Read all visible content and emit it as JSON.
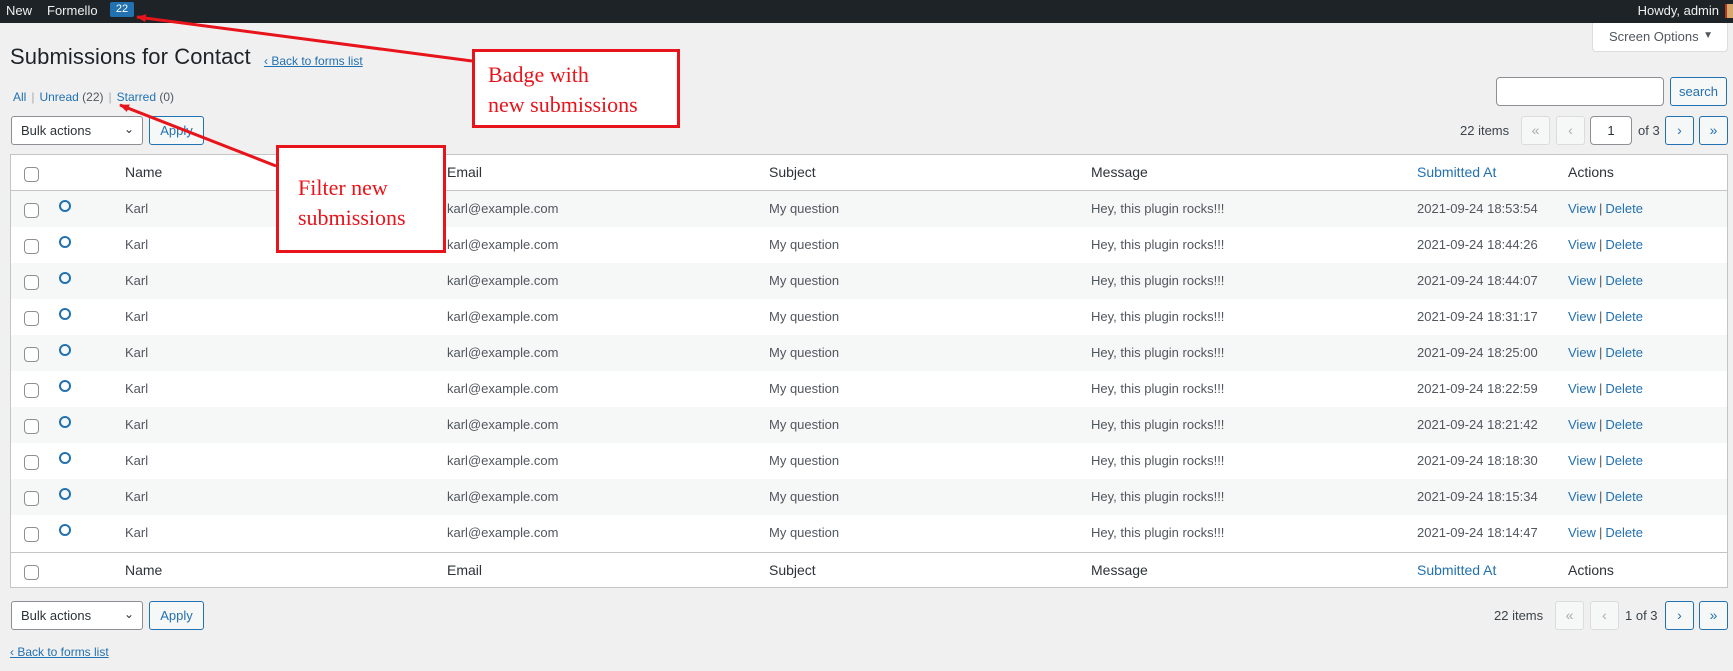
{
  "admin_bar": {
    "new_label": "New",
    "plugin_label": "Formello",
    "badge_count": "22",
    "howdy": "Howdy, admin"
  },
  "screen_options": {
    "label": "Screen Options",
    "caret": "▼"
  },
  "page": {
    "title": "Submissions for Contact",
    "back_link": "‹ Back to forms list"
  },
  "views": {
    "all": "All",
    "sep": "|",
    "unread_label": "Unread",
    "unread_count": "(22)",
    "starred_label": "Starred",
    "starred_count": "(0)"
  },
  "search": {
    "placeholder": "",
    "button": "search"
  },
  "bulk": {
    "label": "Bulk actions",
    "chevron": "⌄",
    "apply": "Apply"
  },
  "pagination_top": {
    "items": "22 items",
    "first": "«",
    "prev": "‹",
    "current": "1",
    "of": "of 3",
    "next": "›",
    "last": "»"
  },
  "pagination_bottom": {
    "items": "22 items",
    "first": "«",
    "prev": "‹",
    "current_text": "1 of 3",
    "next": "›",
    "last": "»"
  },
  "columns": {
    "name": "Name",
    "email": "Email",
    "subject": "Subject",
    "message": "Message",
    "submitted_at": "Submitted At",
    "actions": "Actions"
  },
  "actions": {
    "view": "View",
    "sep": "|",
    "delete": "Delete"
  },
  "rows": [
    {
      "name": "Karl",
      "email": "karl@example.com",
      "subject": "My question",
      "message": "Hey, this plugin rocks!!!",
      "date": "2021-09-24 18:53:54"
    },
    {
      "name": "Karl",
      "email": "karl@example.com",
      "subject": "My question",
      "message": "Hey, this plugin rocks!!!",
      "date": "2021-09-24 18:44:26"
    },
    {
      "name": "Karl",
      "email": "karl@example.com",
      "subject": "My question",
      "message": "Hey, this plugin rocks!!!",
      "date": "2021-09-24 18:44:07"
    },
    {
      "name": "Karl",
      "email": "karl@example.com",
      "subject": "My question",
      "message": "Hey, this plugin rocks!!!",
      "date": "2021-09-24 18:31:17"
    },
    {
      "name": "Karl",
      "email": "karl@example.com",
      "subject": "My question",
      "message": "Hey, this plugin rocks!!!",
      "date": "2021-09-24 18:25:00"
    },
    {
      "name": "Karl",
      "email": "karl@example.com",
      "subject": "My question",
      "message": "Hey, this plugin rocks!!!",
      "date": "2021-09-24 18:22:59"
    },
    {
      "name": "Karl",
      "email": "karl@example.com",
      "subject": "My question",
      "message": "Hey, this plugin rocks!!!",
      "date": "2021-09-24 18:21:42"
    },
    {
      "name": "Karl",
      "email": "karl@example.com",
      "subject": "My question",
      "message": "Hey, this plugin rocks!!!",
      "date": "2021-09-24 18:18:30"
    },
    {
      "name": "Karl",
      "email": "karl@example.com",
      "subject": "My question",
      "message": "Hey, this plugin rocks!!!",
      "date": "2021-09-24 18:15:34"
    },
    {
      "name": "Karl",
      "email": "karl@example.com",
      "subject": "My question",
      "message": "Hey, this plugin rocks!!!",
      "date": "2021-09-24 18:14:47"
    }
  ],
  "annotations": {
    "badge_line1": "Badge with",
    "badge_line2": "new submissions",
    "filter_line1": "Filter new",
    "filter_line2": "submissions"
  },
  "colors": {
    "admin_bar": "#1d2327",
    "accent": "#2271b1",
    "annotation": "#e8141b",
    "background": "#f0f0f1"
  }
}
